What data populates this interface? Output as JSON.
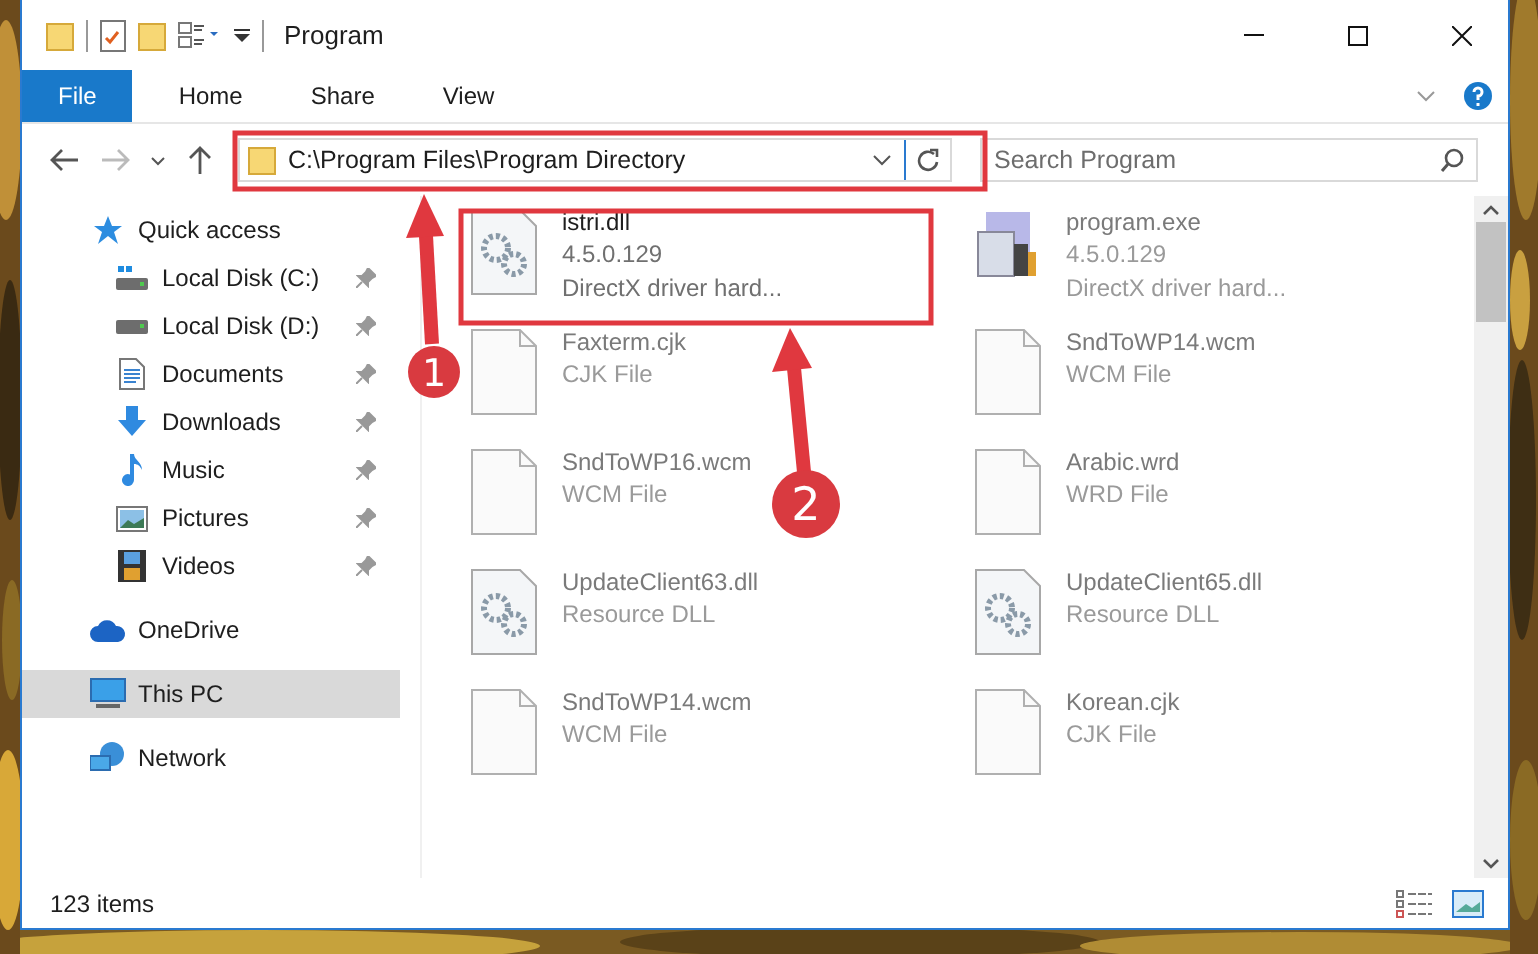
{
  "window": {
    "title": "Program"
  },
  "ribbon": {
    "tabs": [
      {
        "label": "File",
        "kind": "file",
        "selected": false
      },
      {
        "label": "Home",
        "kind": "tab",
        "selected": false
      },
      {
        "label": "Share",
        "kind": "tab",
        "selected": false
      },
      {
        "label": "View",
        "kind": "tab",
        "selected": false
      }
    ]
  },
  "address_bar": {
    "path": "C:\\Program Files\\Program Directory"
  },
  "search": {
    "placeholder": "Search Program"
  },
  "nav": {
    "items": [
      {
        "label": "Quick access",
        "kind": "star",
        "selected": false,
        "children": [
          {
            "label": "Local Disk (C:)",
            "kind": "drive-c",
            "selected": false,
            "pinned": true
          },
          {
            "label": "Local Disk (D:)",
            "kind": "drive",
            "selected": false,
            "pinned": true
          },
          {
            "label": "Documents",
            "kind": "documents",
            "selected": false,
            "pinned": true
          },
          {
            "label": "Downloads",
            "kind": "downloads",
            "selected": false,
            "pinned": true
          },
          {
            "label": "Music",
            "kind": "music",
            "selected": false,
            "pinned": true
          },
          {
            "label": "Pictures",
            "kind": "pictures",
            "selected": false,
            "pinned": true
          },
          {
            "label": "Videos",
            "kind": "videos",
            "selected": false,
            "pinned": true
          }
        ]
      },
      {
        "label": "OneDrive",
        "kind": "cloud",
        "selected": false
      },
      {
        "label": "This PC",
        "kind": "pc",
        "selected": true
      },
      {
        "label": "Network",
        "kind": "network",
        "selected": false
      }
    ]
  },
  "files": [
    {
      "name": "istri.dll",
      "kind": "dll",
      "highlighted": true,
      "details": [
        "4.5.0.129",
        "DirectX driver hard..."
      ]
    },
    {
      "name": "program.exe",
      "kind": "exe",
      "highlighted": false,
      "details": [
        "4.5.0.129",
        "DirectX driver hard..."
      ]
    },
    {
      "name": "Faxterm.cjk",
      "kind": "doc",
      "highlighted": false,
      "details": [
        "CJK File"
      ]
    },
    {
      "name": "SndToWP14.wcm",
      "kind": "doc",
      "highlighted": false,
      "details": [
        "WCM File"
      ]
    },
    {
      "name": "SndToWP16.wcm",
      "kind": "doc",
      "highlighted": false,
      "details": [
        "WCM File"
      ]
    },
    {
      "name": "Arabic.wrd",
      "kind": "doc",
      "highlighted": false,
      "details": [
        "WRD File"
      ]
    },
    {
      "name": "UpdateClient63.dll",
      "kind": "dll",
      "highlighted": false,
      "details": [
        "Resource DLL"
      ]
    },
    {
      "name": "UpdateClient65.dll",
      "kind": "dll",
      "highlighted": false,
      "details": [
        "Resource DLL"
      ]
    },
    {
      "name": "SndToWP14.wcm",
      "kind": "doc",
      "highlighted": false,
      "details": [
        "WCM File"
      ]
    },
    {
      "name": "Korean.cjk",
      "kind": "doc",
      "highlighted": false,
      "details": [
        "CJK File"
      ]
    }
  ],
  "callouts": [
    {
      "number": "1"
    },
    {
      "number": "2"
    }
  ],
  "status_bar": {
    "item_count": "123 items"
  }
}
